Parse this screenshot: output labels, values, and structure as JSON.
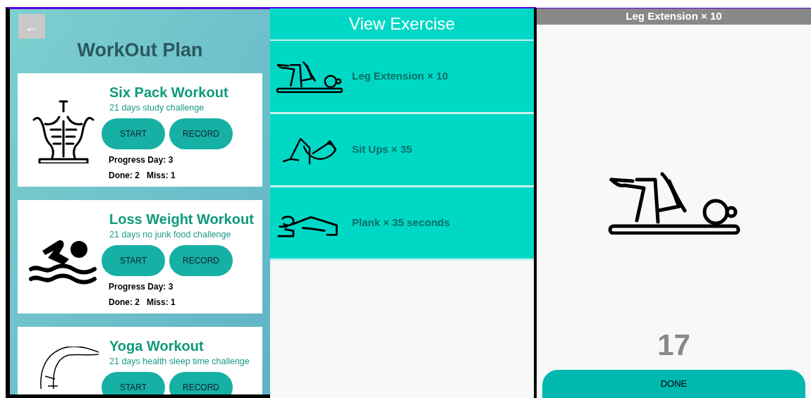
{
  "plan": {
    "back": "←",
    "title": "WorkOut Plan",
    "workouts": [
      {
        "kind": "abs",
        "title": "Six Pack Workout",
        "subtitle": "21 days study challenge",
        "start": "START",
        "record": "RECORD",
        "progress": "Progress Day: 3",
        "done": "Done: 2",
        "miss": "Miss: 1"
      },
      {
        "kind": "swim",
        "title": "Loss Weight Workout",
        "subtitle": "21 days no junk food challenge",
        "start": "START",
        "record": "RECORD",
        "progress": "Progress Day: 3",
        "done": "Done: 2",
        "miss": "Miss: 1"
      },
      {
        "kind": "yoga",
        "title": "Yoga Workout",
        "subtitle": "21 days health sleep time challenge",
        "start": "START",
        "record": "RECORD"
      }
    ]
  },
  "exercises": {
    "title": "View Exercise",
    "items": [
      {
        "kind": "leg",
        "label": "Leg Extension × 10"
      },
      {
        "kind": "situp",
        "label": "Sit Ups × 35"
      },
      {
        "kind": "plank",
        "label": "Plank × 35 seconds"
      }
    ]
  },
  "player": {
    "title": "Leg Extension × 10",
    "kind": "leg",
    "count": "17",
    "button": "DONE"
  }
}
